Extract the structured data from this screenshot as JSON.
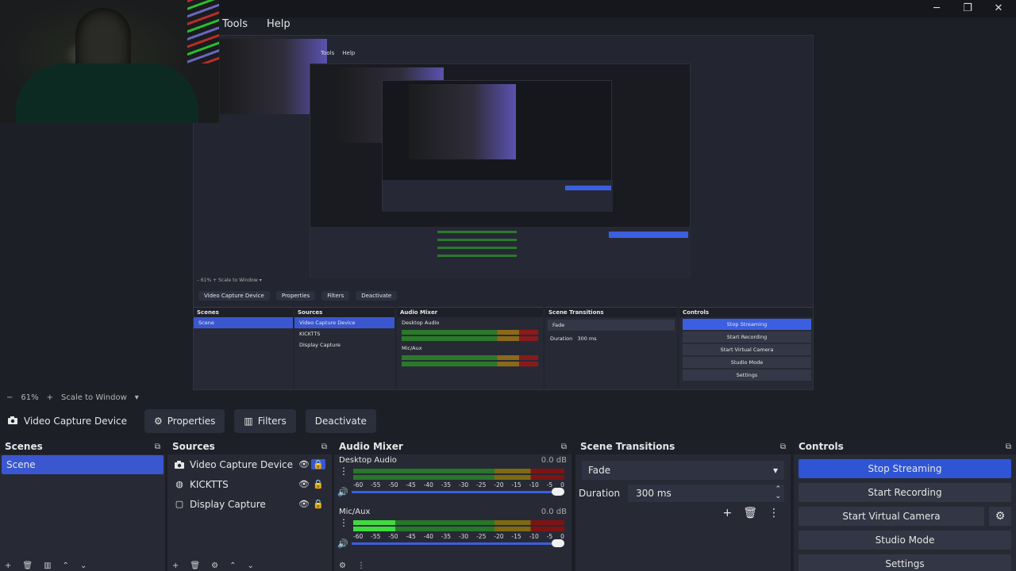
{
  "menu": [
    "Tools",
    "Help"
  ],
  "window_buttons": {
    "minimize": "─",
    "restore": "❐",
    "close": "✕"
  },
  "nested_preview": {
    "menu": [
      "Tools",
      "Help"
    ],
    "scale": "–   61%   +   Scale to Window   ▾",
    "toolbar": [
      "Video Capture Device",
      "Properties",
      "Filters",
      "Deactivate"
    ],
    "scenes_title": "Scenes",
    "scene": "Scene",
    "sources_title": "Sources",
    "sources": [
      "Video Capture Device",
      "KICKTTS",
      "Display Capture"
    ],
    "mixer_title": "Audio Mixer",
    "mixer": [
      "Desktop Audio",
      "Mic/Aux"
    ],
    "trans_title": "Scene Transitions",
    "fade": "Fade",
    "duration": "Duration",
    "duration_val": "300 ms",
    "controls_title": "Controls",
    "controls": [
      "Stop Streaming",
      "Start Recording",
      "Start Virtual Camera",
      "Studio Mode",
      "Settings"
    ]
  },
  "scalebar": {
    "minus": "−",
    "zoom": "61%",
    "plus": "+",
    "mode": "Scale to Window",
    "arrow": "▾"
  },
  "source_toolbar": {
    "source_name": "Video Capture Device",
    "properties": "Properties",
    "filters": "Filters",
    "deactivate": "Deactivate"
  },
  "scenes": {
    "title": "Scenes",
    "items": [
      "Scene"
    ]
  },
  "sources": {
    "title": "Sources",
    "items": [
      {
        "label": "Video Capture Device",
        "icon": "camera-icon"
      },
      {
        "label": "KICKTTS",
        "icon": "browser-icon"
      },
      {
        "label": "Display Capture",
        "icon": "monitor-icon"
      }
    ]
  },
  "mixer": {
    "title": "Audio Mixer",
    "channels": [
      {
        "name": "Desktop Audio",
        "db": "0.0 dB"
      },
      {
        "name": "Mic/Aux",
        "db": "0.0 dB"
      }
    ],
    "ticks": [
      "-60",
      "-55",
      "-50",
      "-45",
      "-40",
      "-35",
      "-30",
      "-25",
      "-20",
      "-15",
      "-10",
      "-5",
      "0"
    ]
  },
  "transitions": {
    "title": "Scene Transitions",
    "selected": "Fade",
    "duration_label": "Duration",
    "duration_value": "300 ms"
  },
  "controls": {
    "title": "Controls",
    "stop_streaming": "Stop Streaming",
    "start_recording": "Start Recording",
    "start_virtual_camera": "Start Virtual Camera",
    "studio_mode": "Studio Mode",
    "settings": "Settings"
  },
  "colors": {
    "accent": "#2f55d4",
    "selection": "#3a57d0",
    "panel": "#272a35",
    "background": "#1d1f26"
  }
}
